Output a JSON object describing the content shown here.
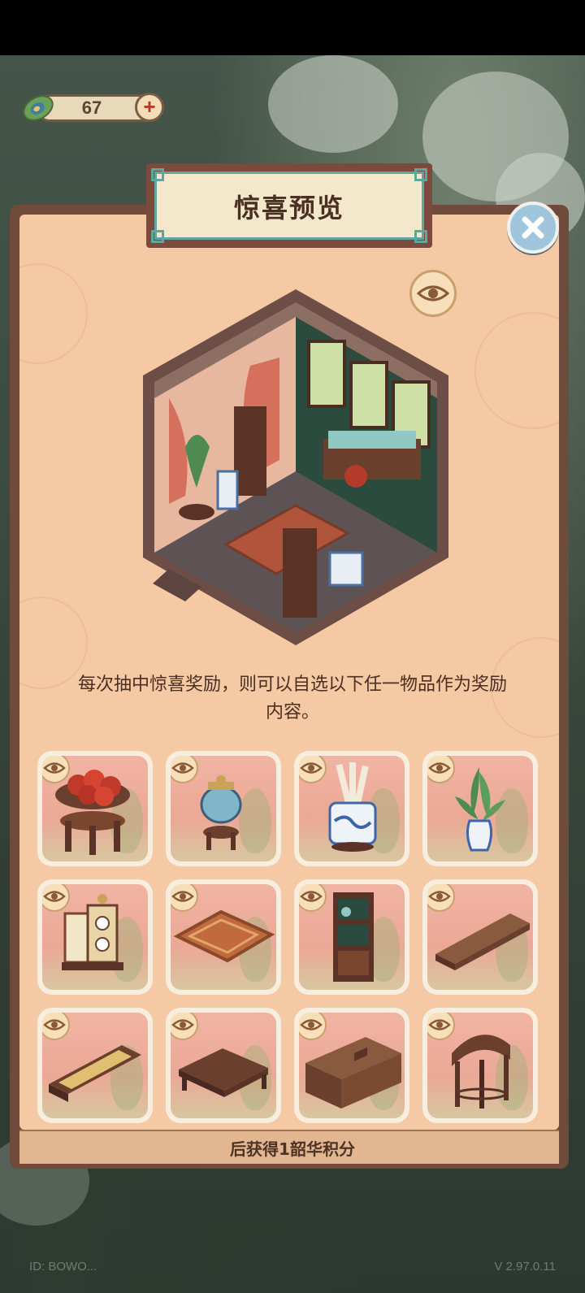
{
  "currency": {
    "amount": "67",
    "icon": "peacock-feather-icon",
    "plus_icon": "plus-icon"
  },
  "dialog": {
    "title": "惊喜预览",
    "description": "每次抽中惊喜奖励，则可以自选以下任一物品作为奖励内容。",
    "footer": "后获得1韶华积分",
    "close_icon": "close-icon",
    "preview_icon": "eye-icon"
  },
  "items": [
    {
      "id": "fruit-table",
      "icon": "apple-bowl-table"
    },
    {
      "id": "censer",
      "icon": "cloisonne-censer"
    },
    {
      "id": "scroll-vase",
      "icon": "blue-white-scroll-vase"
    },
    {
      "id": "plant-vase",
      "icon": "potted-plant-vase"
    },
    {
      "id": "clock-screen",
      "icon": "clock-screen"
    },
    {
      "id": "rug",
      "icon": "patterned-rug"
    },
    {
      "id": "display-shelf",
      "icon": "curio-shelf"
    },
    {
      "id": "long-bench",
      "icon": "long-bench"
    },
    {
      "id": "cushion-bench",
      "icon": "cushion-bench"
    },
    {
      "id": "square-table",
      "icon": "square-table"
    },
    {
      "id": "cabinet",
      "icon": "low-cabinet"
    },
    {
      "id": "half-table",
      "icon": "half-moon-table"
    }
  ],
  "footer_info": {
    "left": "ID: BOWO...",
    "right": "V 2.97.0.11"
  },
  "colors": {
    "panel_frame": "#6e4b3b",
    "panel_fill": "#f4c9a3",
    "title_border": "#5fa69d",
    "card_bg": "#f1b4a3",
    "close_button": "#9ec5db"
  }
}
